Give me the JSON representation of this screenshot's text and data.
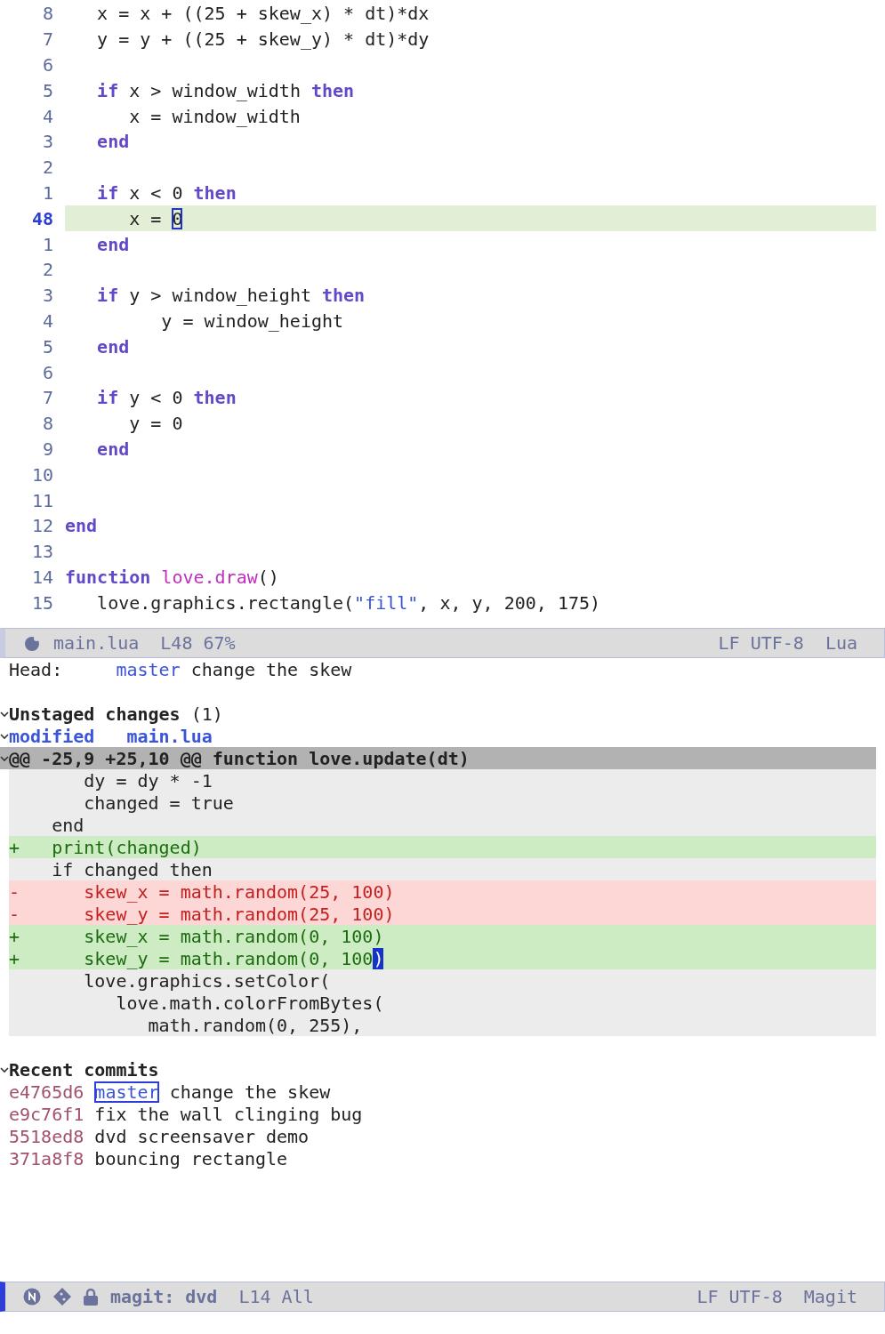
{
  "editor": {
    "lines": [
      {
        "number": "8",
        "current": false,
        "tokens": [
          {
            "kind": "plain",
            "text": "   x = x + ((25 + skew_x) * dt)*dx"
          }
        ]
      },
      {
        "number": "7",
        "current": false,
        "tokens": [
          {
            "kind": "plain",
            "text": "   y = y + ((25 + skew_y) * dt)*dy"
          }
        ]
      },
      {
        "number": "6",
        "current": false
      },
      {
        "number": "5",
        "current": false,
        "tokens": [
          {
            "kind": "keyword",
            "text": "   if"
          },
          {
            "kind": "plain",
            "text": " x > window_width "
          },
          {
            "kind": "keyword",
            "text": "then"
          }
        ]
      },
      {
        "number": "4",
        "current": false,
        "tokens": [
          {
            "kind": "plain",
            "text": "      x = window_width"
          }
        ]
      },
      {
        "number": "3",
        "current": false,
        "tokens": [
          {
            "kind": "keyword",
            "text": "   end"
          }
        ]
      },
      {
        "number": "2",
        "current": false
      },
      {
        "number": "1",
        "current": false,
        "tokens": [
          {
            "kind": "keyword",
            "text": "   if"
          },
          {
            "kind": "plain",
            "text": " x < 0 "
          },
          {
            "kind": "keyword",
            "text": "then"
          }
        ]
      },
      {
        "number": "48",
        "current": true,
        "tokens": [
          {
            "kind": "plain",
            "text": "      x = "
          },
          {
            "kind": "cursor",
            "text": "0"
          }
        ]
      },
      {
        "number": "1",
        "current": false,
        "tokens": [
          {
            "kind": "keyword",
            "text": "   end"
          }
        ]
      },
      {
        "number": "2",
        "current": false
      },
      {
        "number": "3",
        "current": false,
        "tokens": [
          {
            "kind": "keyword",
            "text": "   if"
          },
          {
            "kind": "plain",
            "text": " y > window_height "
          },
          {
            "kind": "keyword",
            "text": "then"
          }
        ]
      },
      {
        "number": "4",
        "current": false,
        "tokens": [
          {
            "kind": "plain",
            "text": "         y = window_height"
          }
        ]
      },
      {
        "number": "5",
        "current": false,
        "tokens": [
          {
            "kind": "keyword",
            "text": "   end"
          }
        ]
      },
      {
        "number": "6",
        "current": false
      },
      {
        "number": "7",
        "current": false,
        "tokens": [
          {
            "kind": "keyword",
            "text": "   if"
          },
          {
            "kind": "plain",
            "text": " y < 0 "
          },
          {
            "kind": "keyword",
            "text": "then"
          }
        ]
      },
      {
        "number": "8",
        "current": false,
        "tokens": [
          {
            "kind": "plain",
            "text": "      y = 0"
          }
        ]
      },
      {
        "number": "9",
        "current": false,
        "tokens": [
          {
            "kind": "keyword",
            "text": "   end"
          }
        ]
      },
      {
        "number": "10",
        "current": false
      },
      {
        "number": "11",
        "current": false
      },
      {
        "number": "12",
        "current": false,
        "tokens": [
          {
            "kind": "keyword",
            "text": "end"
          }
        ]
      },
      {
        "number": "13",
        "current": false
      },
      {
        "number": "14",
        "current": false,
        "tokens": [
          {
            "kind": "keyword",
            "text": "function"
          },
          {
            "kind": "function",
            "text": " love.draw"
          },
          {
            "kind": "plain",
            "text": "()"
          }
        ]
      },
      {
        "number": "15",
        "current": false,
        "tokens": [
          {
            "kind": "plain",
            "text": "   love.graphics.rectangle("
          },
          {
            "kind": "string",
            "text": "\"fill\""
          },
          {
            "kind": "plain",
            "text": ", x, y, 200, 175)"
          }
        ]
      }
    ]
  },
  "editor_mode_line": {
    "file": "main.lua",
    "position": "L48 67%",
    "encoding": "LF UTF-8",
    "mode": "Lua"
  },
  "magit": {
    "head": {
      "label": "Head:",
      "branch": "master",
      "message": "change the skew"
    },
    "unstaged": {
      "title": "Unstaged changes",
      "count": "(1)",
      "expanded": true
    },
    "file": {
      "status": "modified",
      "name": "main.lua",
      "expanded": true
    },
    "hunk": {
      "header": "@@ -25,9 +25,10 @@ function love.update(dt)",
      "expanded": true
    },
    "diff_lines": [
      {
        "kind": "context",
        "text": "      dy = dy * -1"
      },
      {
        "kind": "context",
        "text": "      changed = true"
      },
      {
        "kind": "context",
        "text": "   end"
      },
      {
        "kind": "added",
        "sign": "+",
        "text": "   print(changed)"
      },
      {
        "kind": "context",
        "text": "   if changed then"
      },
      {
        "kind": "removed",
        "sign": "-",
        "text": "      skew_x = math.random(25, 100)"
      },
      {
        "kind": "removed",
        "sign": "-",
        "text": "      skew_y = math.random(25, 100)"
      },
      {
        "kind": "added",
        "sign": "+",
        "text": "      skew_x = math.random(0, 100)"
      },
      {
        "kind": "added",
        "sign": "+",
        "text": "      skew_y = math.random(0, 100",
        "cursor": ")"
      },
      {
        "kind": "context",
        "text": "      love.graphics.setColor("
      },
      {
        "kind": "context",
        "text": "         love.math.colorFromBytes("
      },
      {
        "kind": "context",
        "text": "            math.random(0, 255),"
      }
    ],
    "recent": {
      "title": "Recent commits",
      "expanded": true,
      "commits": [
        {
          "hash": "e4765d6",
          "branch": "master",
          "selected": true,
          "message": "change the skew"
        },
        {
          "hash": "e9c76f1",
          "message": "fix the wall clinging bug"
        },
        {
          "hash": "5518ed8",
          "message": "dvd screensaver demo"
        },
        {
          "hash": "371a8f8",
          "message": "bouncing rectangle"
        }
      ]
    }
  },
  "magit_mode_line": {
    "buffer": "magit: dvd",
    "position": "L14 All",
    "encoding": "LF UTF-8",
    "mode": "Magit"
  }
}
